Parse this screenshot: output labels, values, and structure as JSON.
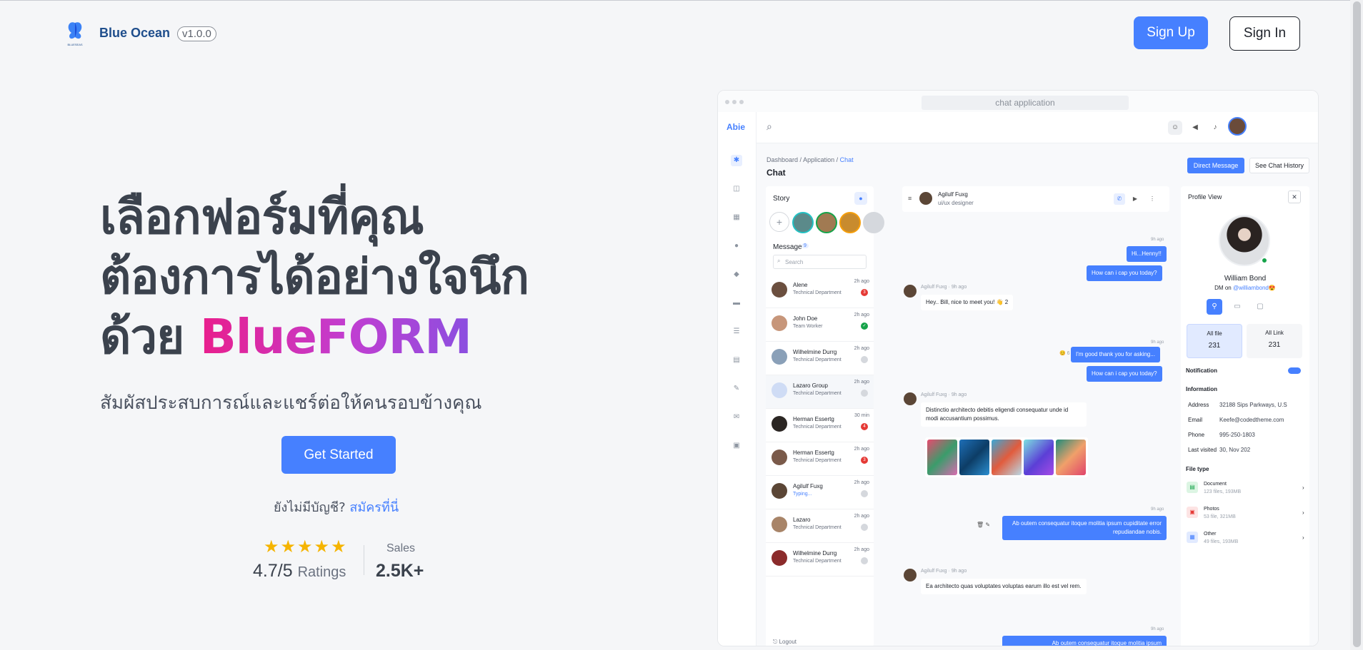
{
  "header": {
    "brand": "Blue Ocean",
    "version": "v1.0.0",
    "logo_text": "BLUESEAS",
    "signup_label": "Sign Up",
    "signin_label": "Sign In"
  },
  "hero": {
    "title_line1": "เลือกฟอร์มที่คุณ",
    "title_line2": "ต้องการได้อย่างใจนึก",
    "title_prefix3": "ด้วย ",
    "title_highlight": "BlueFORM",
    "subtitle": "สัมผัสประสบการณ์และแชร์ต่อให้คนรอบข้างคุณ",
    "cta_label": "Get Started",
    "no_account_text": "ยังไม่มีบัญชี?",
    "register_link": "สมัครที่นี่",
    "stars": "★★★★★",
    "rating_value": "4.7/5",
    "rating_label": "Ratings",
    "sales_label": "Sales",
    "sales_value": "2.5K+"
  },
  "mock": {
    "url": "chat application",
    "app_name": "Abie",
    "breadcrumb": [
      "Dashboard",
      "/",
      "Application",
      "/",
      "Chat"
    ],
    "page_title": "Chat",
    "direct_message": "Direct Message",
    "see_chat_history": "See Chat History",
    "story_title": "Story",
    "message_title": "Message",
    "message_count": "9",
    "search_placeholder": "Search",
    "contacts": [
      {
        "name": "Alene",
        "role": "Technical Department",
        "time": "2h ago",
        "badge": "3",
        "badge_color": "#e53935"
      },
      {
        "name": "John Doe",
        "role": "Team Worker",
        "time": "2h ago",
        "badge": "✓",
        "badge_color": "#16a34a"
      },
      {
        "name": "Wilhelmine Durrg",
        "role": "Technical Department",
        "time": "2h ago",
        "badge": "",
        "badge_color": "#d5d8dd"
      },
      {
        "name": "Lazaro Group",
        "role": "Technical Department",
        "time": "2h ago",
        "badge": "",
        "badge_color": "#d5d8dd"
      },
      {
        "name": "Herman Essertg",
        "role": "Technical Department",
        "time": "30 min",
        "badge": "4",
        "badge_color": "#e53935"
      },
      {
        "name": "Herman Essertg",
        "role": "Technical Department",
        "time": "2h ago",
        "badge": "3",
        "badge_color": "#e53935"
      },
      {
        "name": "Agilulf Fuxg",
        "role": "Typing...",
        "time": "2h ago",
        "badge": "",
        "badge_color": "#d5d8dd"
      },
      {
        "name": "Lazaro",
        "role": "Technical Department",
        "time": "2h ago",
        "badge": "",
        "badge_color": "#d5d8dd"
      },
      {
        "name": "Wilhelmine Durrg",
        "role": "Technical Department",
        "time": "2h ago",
        "badge": "",
        "badge_color": "#d5d8dd"
      }
    ],
    "logout": "Logout",
    "chat_user_name": "Agilulf Fuxg",
    "chat_user_role": "ui/ux designer",
    "messages": {
      "t1": "9h ago",
      "out1": "Hi...Henny!!",
      "out2": "How can i cap you today?",
      "in_name": "Agilulf Fuxg",
      "in_time": "9h ago",
      "in1": "Hey.. Bill, nice to meet you!",
      "in1_react": "👋 2",
      "t2": "9h ago",
      "out3_react": "😊 6",
      "out3": "I'm good thank you for asking...",
      "out4": "How can i cap you today?",
      "in2": "Distinctio architecto debitis eligendi consequatur unde id modi accusantium possimus.",
      "t3": "9h ago",
      "out5": "Ab outem consequatur itoque molitia ipsum cupiditate error repudiandae nobis.",
      "in3": "Ea architecto quas voluptates voluptas earum illo est vel rem.",
      "t4": "9h ago",
      "out6": "Ab outem consequatur itoque molitia ipsum"
    },
    "profile": {
      "title": "Profile View",
      "name": "William Bond",
      "dm_prefix": "DM on ",
      "dm_handle": "@williambond😍",
      "all_file_label": "All file",
      "all_file_count": "231",
      "all_link_label": "All Link",
      "all_link_count": "231",
      "notification": "Notification",
      "information": "Information",
      "info": [
        {
          "k": "Address",
          "v": "32188 Sips Parkways, U.S"
        },
        {
          "k": "Email",
          "v": "Keefe@codedtheme.com"
        },
        {
          "k": "Phone",
          "v": "995-250-1803"
        },
        {
          "k": "Last visited",
          "v": "30, Nov 202"
        }
      ],
      "file_type": "File type",
      "files": [
        {
          "name": "Document",
          "size": "123 files, 193MB",
          "color": "#16a34a",
          "bg": "#dcf5e3"
        },
        {
          "name": "Photos",
          "size": "53 file, 321MB",
          "color": "#e53935",
          "bg": "#fde4e4"
        },
        {
          "name": "Other",
          "size": "49 files, 193MB",
          "color": "#4680ff",
          "bg": "#e1eaff"
        }
      ]
    }
  },
  "colors": {
    "accent": "#4680ff",
    "gradient_start": "#e91e8c",
    "gradient_end": "#8a4fe0",
    "star": "#f5b400"
  }
}
